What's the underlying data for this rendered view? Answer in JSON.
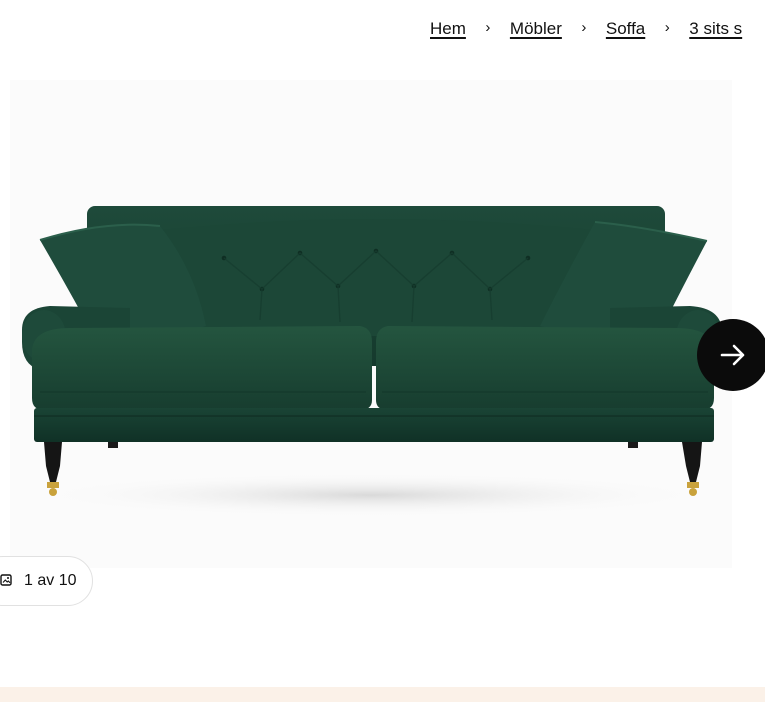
{
  "breadcrumb": {
    "items": [
      {
        "label": "Hem"
      },
      {
        "label": "Möbler"
      },
      {
        "label": "Soffa"
      },
      {
        "label": "3 sits s"
      }
    ],
    "separator_icon": "chevron-right-icon"
  },
  "gallery": {
    "image_alt": "Grön sammetssoffa",
    "next_icon": "arrow-right-icon",
    "counter_text": "1 av 10",
    "counter_icon": "image-gallery-icon"
  },
  "colors": {
    "sofa_green": "#1f4a3b",
    "button_bg": "#0b0b0b",
    "band": "#fbf1e8"
  }
}
